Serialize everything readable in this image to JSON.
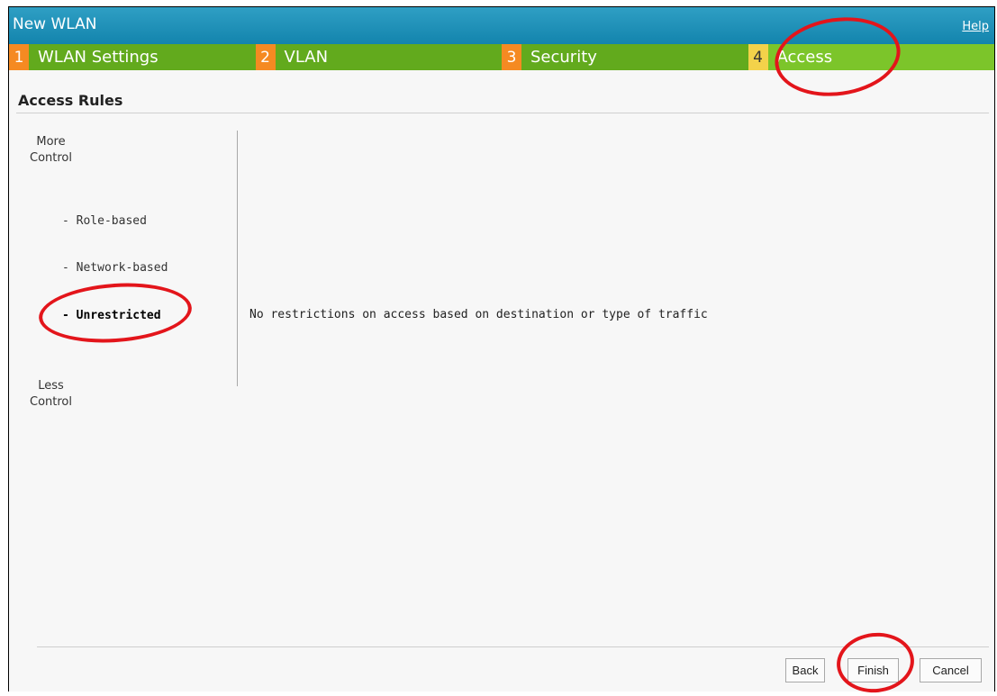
{
  "window": {
    "title": "New WLAN",
    "help_link": "Help"
  },
  "tabs": [
    {
      "number": "1",
      "label": "WLAN Settings"
    },
    {
      "number": "2",
      "label": "VLAN"
    },
    {
      "number": "3",
      "label": "Security"
    },
    {
      "number": "4",
      "label": "Access"
    }
  ],
  "section": {
    "title": "Access Rules"
  },
  "scale": {
    "top_label": "More\nControl",
    "bottom_label": "Less\nControl"
  },
  "options": [
    {
      "label": "- Role-based"
    },
    {
      "label": "- Network-based"
    },
    {
      "label": "- Unrestricted",
      "selected": true
    }
  ],
  "description": "No restrictions on access based on destination or type of traffic",
  "buttons": {
    "back": "Back",
    "finish": "Finish",
    "cancel": "Cancel"
  },
  "colors": {
    "titlebar": "#1f91b8",
    "tab_green": "#62aa1d",
    "tab_active_green": "#7cc52a",
    "tab_number_orange": "#f58a22",
    "tab_number_active": "#f3d24a",
    "annotation_red": "#e3151b"
  }
}
